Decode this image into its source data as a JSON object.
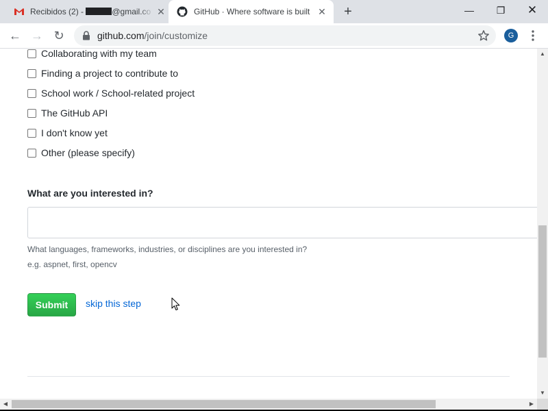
{
  "browser": {
    "tabs": [
      {
        "title_prefix": "Recibidos (2) - ",
        "title_suffix": "@gmail.com",
        "close_glyph": "✕",
        "favicon": "gmail-icon",
        "active": false
      },
      {
        "title": "GitHub · Where software is built",
        "close_glyph": "✕",
        "favicon": "github-icon",
        "active": true
      }
    ],
    "new_tab_glyph": "+",
    "window_controls": {
      "minimize_glyph": "—",
      "maximize_glyph": "❐",
      "close_glyph": "✕"
    },
    "toolbar": {
      "back_glyph": "←",
      "forward_glyph": "→",
      "reload_glyph": "↻"
    },
    "address_bar": {
      "domain": "github.com",
      "path": "/join/customize"
    },
    "profile_initial": "G"
  },
  "form": {
    "options": [
      "Collaborating with my team",
      "Finding a project to contribute to",
      "School work / School-related project",
      "The GitHub API",
      "I don't know yet",
      "Other (please specify)"
    ],
    "interests": {
      "heading": "What are you interested in?",
      "value": "",
      "help": "What languages, frameworks, industries, or disciplines are you interested in?",
      "example": "e.g. aspnet, first, opencv"
    },
    "submit_label": "Submit",
    "skip_label": "skip this step"
  },
  "scrollbars": {
    "up_glyph": "▲",
    "down_glyph": "▼",
    "left_glyph": "◀",
    "right_glyph": "▶"
  },
  "colors": {
    "submit_green": "#2ea44f",
    "link_blue": "#0366d6",
    "profile_blue": "#1a5e9c"
  }
}
